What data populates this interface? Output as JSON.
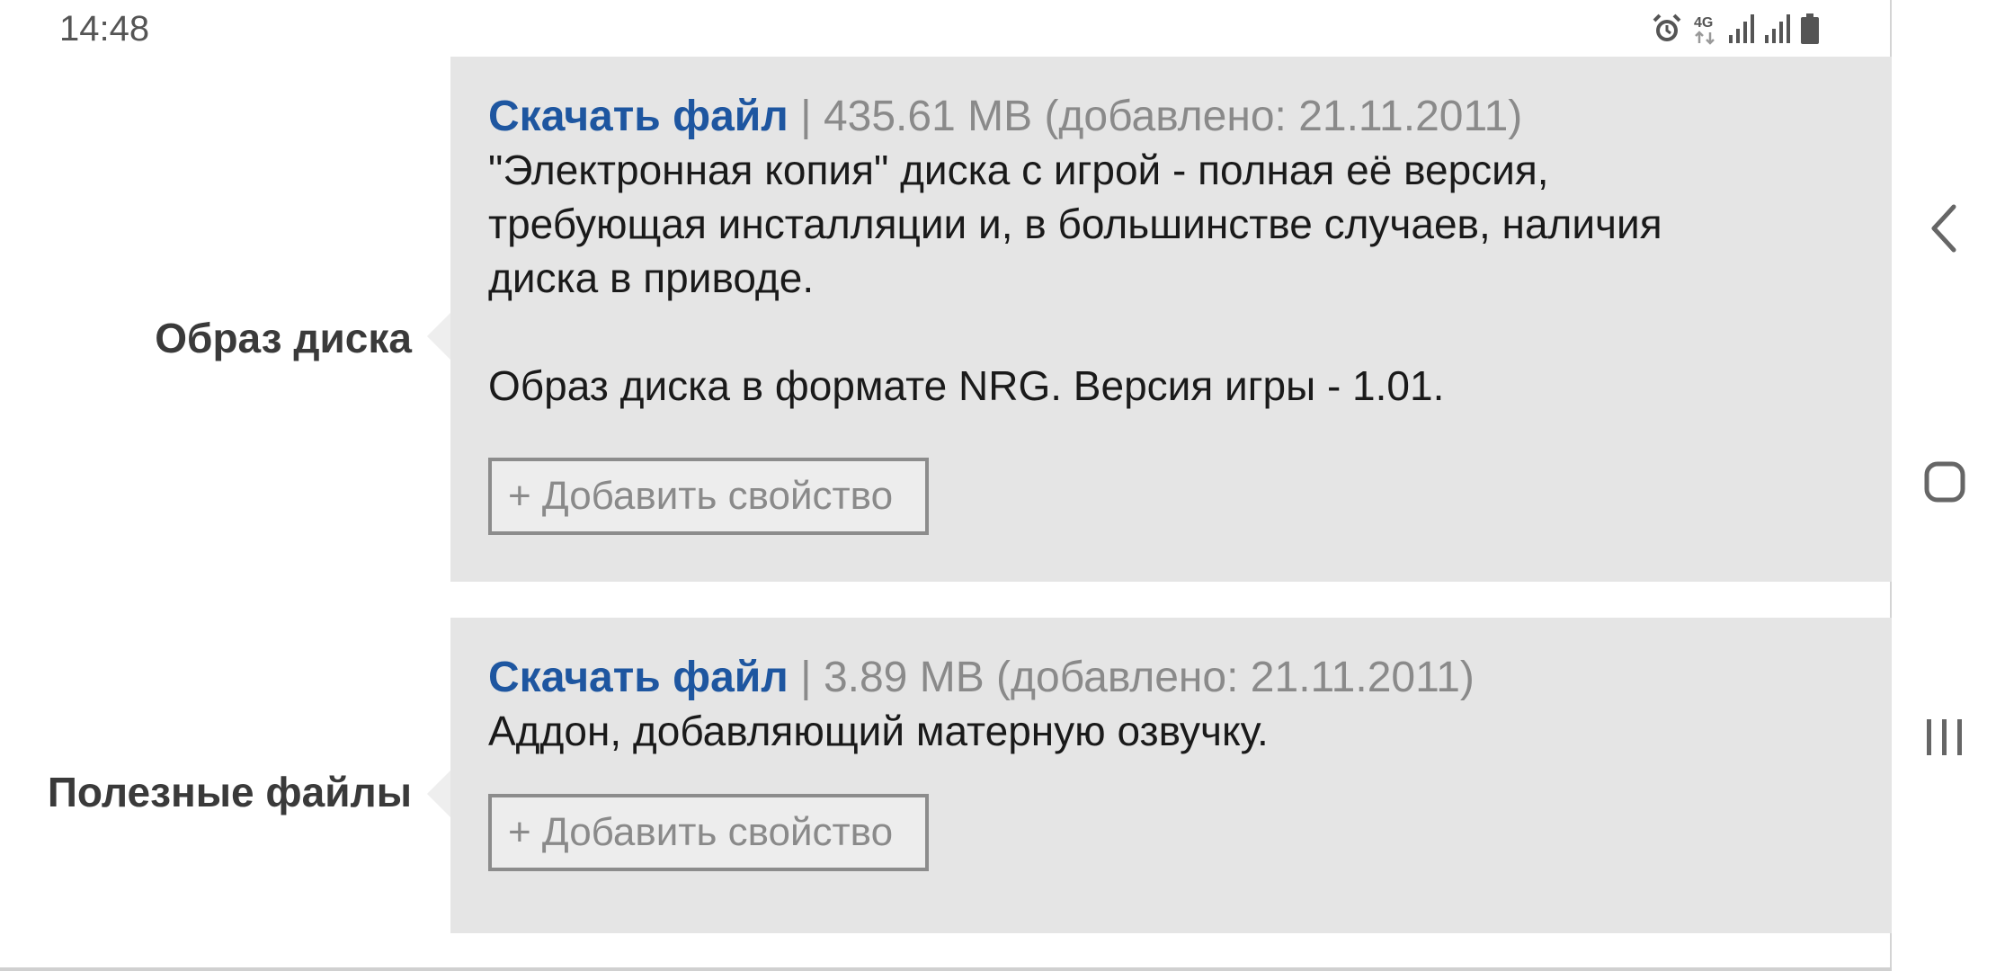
{
  "status_bar": {
    "time": "14:48",
    "icons": [
      "alarm-icon",
      "4g-icon",
      "signal-icon",
      "signal-icon",
      "battery-icon"
    ],
    "network_label": "4G"
  },
  "rows": [
    {
      "label": "Образ диска",
      "download_label": "Скачать файл",
      "separator": "|",
      "meta": "435.61 MB (добавлено: 21.11.2011)",
      "description": [
        "\"Электронная копия\" диска с игрой - полная её версия,",
        "требующая инсталляции и, в большинстве случаев, наличия",
        "диска в приводе.",
        "",
        "Образ диска в формате NRG. Версия игры - 1.01."
      ],
      "add_property_label": "+ Добавить свойство"
    },
    {
      "label": "Полезные файлы",
      "download_label": "Скачать файл",
      "separator": "|",
      "meta": "3.89 MB (добавлено: 21.11.2011)",
      "description": [
        "Аддон, добавляющий матерную озвучку."
      ],
      "add_property_label": "+ Добавить свойство"
    }
  ],
  "nav_bar": {
    "buttons": [
      "back-icon",
      "home-icon",
      "recent-apps-icon"
    ]
  },
  "colors": {
    "link": "#1e56a0",
    "panel_bg": "#e5e5e5",
    "meta_text": "#8a8a8a",
    "label_text": "#3a3a3a"
  }
}
